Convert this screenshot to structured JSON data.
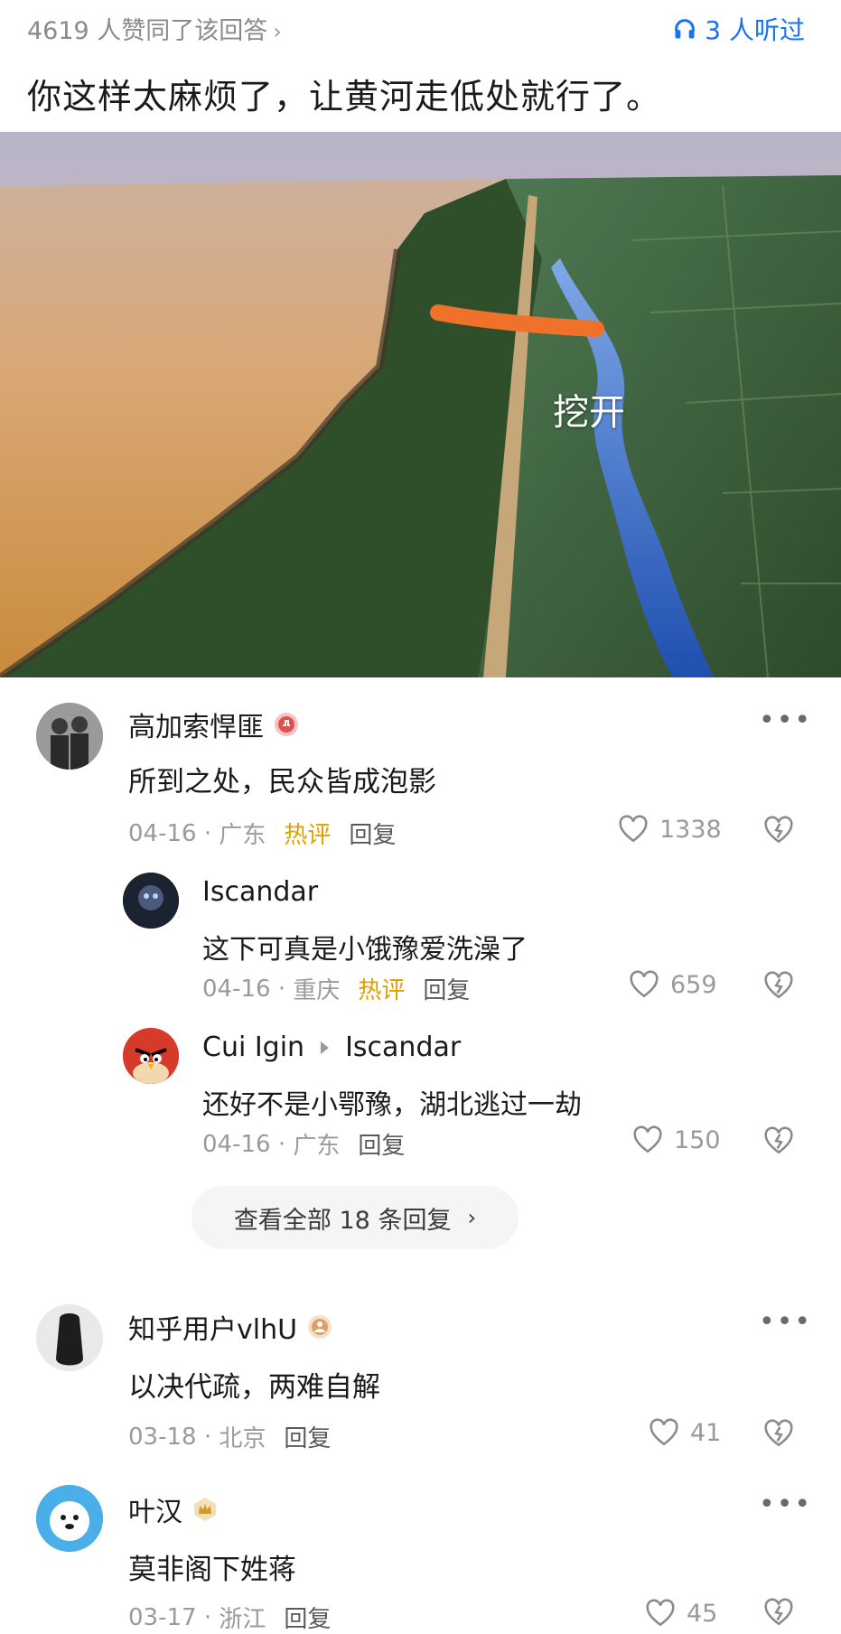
{
  "header": {
    "likes_text": "4619 人赞同了该回答",
    "listen_text": "3 人听过"
  },
  "answer": {
    "text": "你这样太麻烦了，让黄河走低处就行了。",
    "image_annotation": "挖开"
  },
  "comments": [
    {
      "user": "高加索悍匪",
      "text": "所到之处，民众皆成泡影",
      "date": "04-16",
      "location": "广东",
      "tag": "热评",
      "reply_label": "回复",
      "likes": "1338",
      "replies": [
        {
          "user": "Iscandar",
          "text": "这下可真是小饿豫爱洗澡了",
          "date": "04-16",
          "location": "重庆",
          "tag": "热评",
          "reply_label": "回复",
          "likes": "659"
        },
        {
          "user": "Cui Igin",
          "reply_to": "Iscandar",
          "text": "还好不是小鄂豫，湖北逃过一劫",
          "date": "04-16",
          "location": "广东",
          "reply_label": "回复",
          "likes": "150"
        }
      ],
      "view_all": "查看全部 18 条回复"
    },
    {
      "user": "知乎用户vlhU",
      "text": "以决代疏，两难自解",
      "date": "03-18",
      "location": "北京",
      "reply_label": "回复",
      "likes": "41"
    },
    {
      "user": "叶汉",
      "text": "莫非阁下姓蒋",
      "date": "03-17",
      "location": "浙江",
      "reply_label": "回复",
      "likes": "45"
    }
  ],
  "colors": {
    "accent_blue": "#1772f6",
    "hot_tag": "#e0a000",
    "muted": "#9a9a9a"
  },
  "icons": [
    "headphones-icon",
    "heart-icon",
    "dislike-heart-icon",
    "more-icon",
    "chevron-right-icon",
    "reply-arrow-icon"
  ]
}
